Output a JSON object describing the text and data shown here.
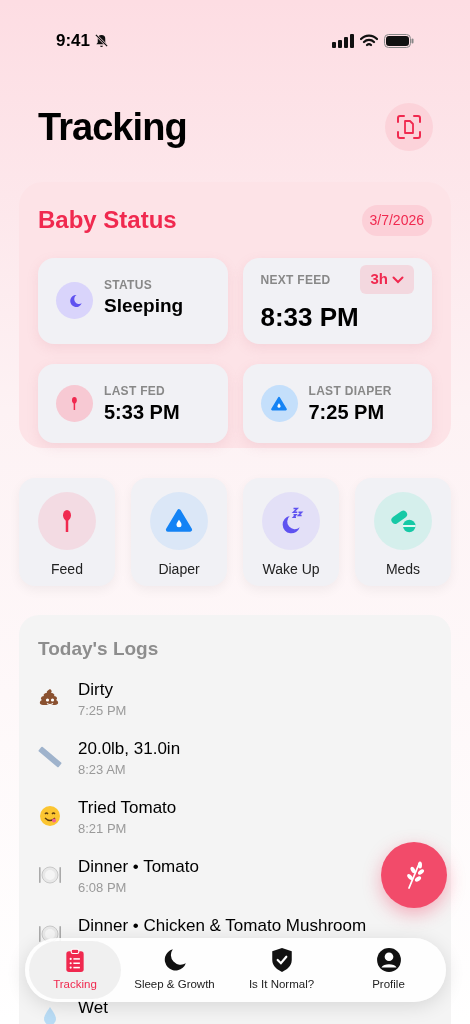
{
  "status_bar": {
    "time": "9:41",
    "silent": true
  },
  "title": "Tracking",
  "baby_status": {
    "title": "Baby Status",
    "date": "3/7/2026",
    "tiles": [
      {
        "kind": "status",
        "label": "STATUS",
        "value": "Sleeping"
      },
      {
        "kind": "next",
        "label": "NEXT FEED",
        "value": "8:33 PM",
        "interval": "3h"
      },
      {
        "kind": "fed",
        "label": "LAST FED",
        "value": "5:33 PM"
      },
      {
        "kind": "diaper",
        "label": "LAST DIAPER",
        "value": "7:25 PM"
      }
    ]
  },
  "quick_actions": [
    {
      "kind": "feed",
      "label": "Feed"
    },
    {
      "kind": "diaper",
      "label": "Diaper"
    },
    {
      "kind": "wake",
      "label": "Wake Up"
    },
    {
      "kind": "meds",
      "label": "Meds"
    }
  ],
  "logs": {
    "title": "Today's Logs",
    "items": [
      {
        "kind": "poop",
        "title": "Dirty",
        "time": "7:25 PM"
      },
      {
        "kind": "ruler",
        "title": "20.0lb, 31.0in",
        "time": "8:23 AM"
      },
      {
        "kind": "face",
        "title": "Tried Tomato",
        "time": "8:21 PM"
      },
      {
        "kind": "plate",
        "title": "Dinner • Tomato",
        "time": "6:08 PM"
      },
      {
        "kind": "plate",
        "title": "Dinner • Chicken & Tomato Mushroom"
      },
      {
        "kind": "drop",
        "title": "Wet"
      }
    ]
  },
  "tabs": [
    {
      "kind": "clipboard",
      "label": "Tracking",
      "selected": true
    },
    {
      "kind": "moon",
      "label": "Sleep & Growth",
      "selected": false
    },
    {
      "kind": "shield",
      "label": "Is It Normal?",
      "selected": false
    },
    {
      "kind": "person",
      "label": "Profile",
      "selected": false
    }
  ]
}
